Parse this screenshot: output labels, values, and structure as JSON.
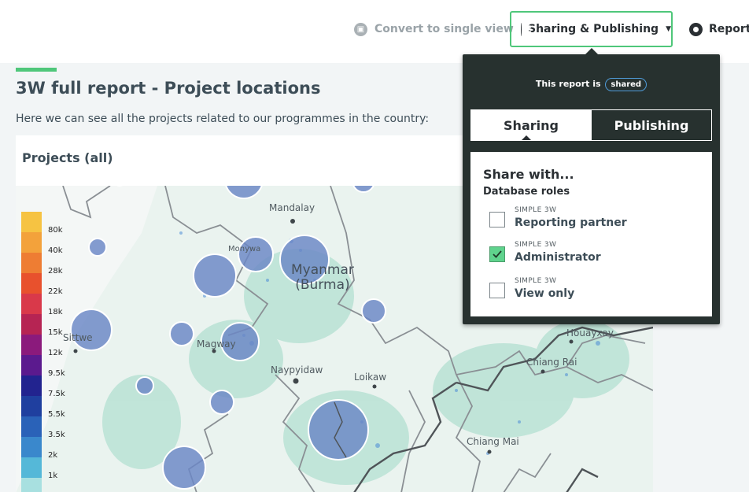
{
  "toolbar": {
    "convert_label": "Convert to single view",
    "share_label": "Sharing & Publishing",
    "report_label": "Report s"
  },
  "page": {
    "title": "3W full report - Project locations",
    "description": "Here we can see all the projects related to our programmes in the country:"
  },
  "panel": {
    "title": "Projects (all)"
  },
  "map": {
    "labels": {
      "mandalay": "Mandalay",
      "monywa": "Monywa",
      "country_line1": "Myanmar",
      "country_line2": "(Burma)",
      "sittwe": "Sittwe",
      "magway": "Magway",
      "naypyidaw": "Naypyidaw",
      "loikaw": "Loikaw",
      "houayxay": "Houayxay",
      "chiang_rai": "Chiang Rai",
      "chiang_mai": "Chiang Mai"
    },
    "legend": [
      {
        "label": "80k",
        "color": "#f6c342"
      },
      {
        "label": "40k",
        "color": "#f3a23b"
      },
      {
        "label": "28k",
        "color": "#ee7d33"
      },
      {
        "label": "22k",
        "color": "#e8512d"
      },
      {
        "label": "18k",
        "color": "#d9394a"
      },
      {
        "label": "15k",
        "color": "#b62453"
      },
      {
        "label": "12k",
        "color": "#8b1a7c"
      },
      {
        "label": "9.5k",
        "color": "#5b1a8e"
      },
      {
        "label": "7.5k",
        "color": "#22238f"
      },
      {
        "label": "5.5k",
        "color": "#1f3f9f"
      },
      {
        "label": "3.5k",
        "color": "#2a62b8"
      },
      {
        "label": "2k",
        "color": "#3a88cc"
      },
      {
        "label": "1k",
        "color": "#55b8d8"
      },
      {
        "label": "",
        "color": "#a8e0e0"
      }
    ]
  },
  "sharing": {
    "status_prefix": "This report is",
    "status_value": "shared",
    "tabs": [
      "Sharing",
      "Publishing"
    ],
    "heading": "Share with...",
    "subheading": "Database roles",
    "roles": [
      {
        "db": "SIMPLE 3W",
        "name": "Reporting partner",
        "checked": false
      },
      {
        "db": "SIMPLE 3W",
        "name": "Administrator",
        "checked": true
      },
      {
        "db": "SIMPLE 3W",
        "name": "View only",
        "checked": false
      }
    ]
  },
  "colors": {
    "accent": "#4fc77a",
    "popover_bg": "#27312f",
    "bubble": "#6a86c6"
  }
}
